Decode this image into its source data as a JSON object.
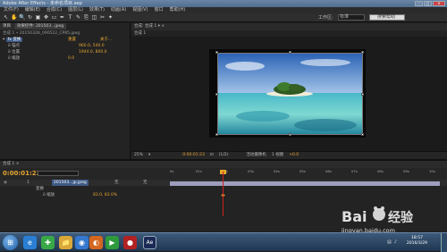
{
  "window": {
    "title": "Adobe After Effects - 未命名项目.aep",
    "buttons": [
      "–",
      "□",
      "✕"
    ]
  },
  "menu": [
    "文件(F)",
    "编辑(E)",
    "合成(C)",
    "图层(L)",
    "效果(T)",
    "动画(A)",
    "视图(V)",
    "窗口",
    "帮助(H)"
  ],
  "toolbar": {
    "tools": [
      "arrow-tool-icon",
      "hand-tool-icon",
      "zoom-tool-icon",
      "rotate-tool-icon",
      "camera-tool-icon",
      "pan-tool-icon",
      "mask-tool-icon",
      "pen-tool-icon",
      "text-tool-icon",
      "brush-tool-icon",
      "clone-tool-icon",
      "eraser-tool-icon",
      "roto-tool-icon",
      "puppet-tool-icon"
    ],
    "tool_glyphs": [
      "↖",
      "✋",
      "🔍",
      "↻",
      "▣",
      "✥",
      "▭",
      "✒",
      "T",
      "✎",
      "⎘",
      "◫",
      "✂",
      "✦"
    ],
    "workspace_label": "工作区:",
    "workspace_value": "标准",
    "search_placeholder": "搜索帮助"
  },
  "left_panel": {
    "tabs": [
      "项目",
      "效果控件: 201503...jpeg"
    ],
    "header": "合成 1 • 20150328_090522_CP85.jpeg",
    "rows": [
      {
        "label": "fx 变换",
        "value": "重置",
        "extra": "关于..."
      },
      {
        "label": "ö 锚点",
        "value": "960.0, 540.0"
      },
      {
        "label": "ö 位置",
        "value": "1944.0, 800.0"
      },
      {
        "label": "ö 缩放",
        "value": "0.0"
      }
    ]
  },
  "comp_panel": {
    "header": "合成: 合成 1 ▾   ×",
    "sub_tab": "合成 1",
    "footer": [
      "25%",
      "▾",
      "0:00:01:23",
      "⊡",
      "(1/2)",
      "活动摄像机",
      "1 视图",
      "+0.0"
    ]
  },
  "timeline": {
    "tab": "合成 1 ×",
    "timecode": "0:00:01:23",
    "ruler": [
      "0s",
      "01s",
      "02s",
      "03s",
      "04s",
      "05s",
      "06s",
      "07s",
      "08s",
      "09s",
      "10s"
    ],
    "layers": [
      {
        "num": "1",
        "name": "201503...jp.jpeg",
        "mode": "无",
        "mode2": "无"
      },
      {
        "name": "变换",
        "value": ""
      },
      {
        "name": "ö 缩放",
        "value": "83.0, 83.0%"
      }
    ]
  },
  "taskbar": {
    "apps": [
      "ie-icon",
      "360-icon",
      "folder-icon",
      "chrome-icon",
      "firefox-icon",
      "media-icon",
      "record-icon",
      "after-effects-icon"
    ],
    "app_glyphs": [
      "e",
      "✚",
      "📁",
      "◉",
      "◐",
      "▶",
      "●",
      "Ae"
    ],
    "time": "18:57",
    "date": "2016/3/29"
  },
  "watermark": {
    "brand": "Baidu经验",
    "url": "jingyan.baidu.com"
  },
  "colors": {
    "accent_orange": "#e5a531",
    "selection": "#3e5a86",
    "playhead": "#d02020",
    "layer_bar": "#9e9ebd"
  }
}
